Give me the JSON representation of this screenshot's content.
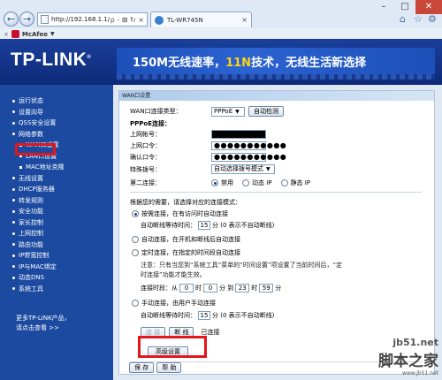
{
  "browser": {
    "url": "http://192.168.1.1/",
    "tab_title": "TL-WR745N",
    "address_icons": "ρ - ⊠ ↻ ×",
    "tab_close": "×",
    "toolbar": {
      "mcafee_label": "McAfee"
    }
  },
  "banner": {
    "logo": "TP-LINK",
    "logo_reg": "®",
    "slogan_pre": "150M无线速率，",
    "slogan_accent": "11N",
    "slogan_post": "技术，无线生活新选择"
  },
  "sidebar": {
    "items": [
      {
        "label": "运行状态"
      },
      {
        "label": "设置向导"
      },
      {
        "label": "QSS安全设置"
      },
      {
        "label": "网络参数"
      },
      {
        "label": "WAN口设置"
      },
      {
        "label": "LAN口设置"
      },
      {
        "label": "MAC地址克隆"
      },
      {
        "label": "无线设置"
      },
      {
        "label": "DHCP服务器"
      },
      {
        "label": "转发规则"
      },
      {
        "label": "安全功能"
      },
      {
        "label": "家长控制"
      },
      {
        "label": "上网控制"
      },
      {
        "label": "路由功能"
      },
      {
        "label": "IP带宽控制"
      },
      {
        "label": "IP与MAC绑定"
      },
      {
        "label": "动态DNS"
      },
      {
        "label": "系统工具"
      }
    ],
    "more_line1": "更多TP-LINK产品，",
    "more_line2": "请点击查看 >>"
  },
  "panel": {
    "title": "WAN口设置",
    "conn_type_label": "WAN口连接类型：",
    "conn_type_value": "PPPoE",
    "auto_detect": "自动检测",
    "pppoe_label": "PPPoE连接：",
    "account_label": "上网帐号：",
    "password_label": "上网口令：",
    "confirm_label": "确认口令：",
    "password_mask": "●●●●●●●●●●●",
    "special_dial_label": "特殊拨号：",
    "special_dial_value": "自动选择拨号模式",
    "second_conn_label": "第二连接：",
    "second_opts": [
      "禁用",
      "动态 IP",
      "静态 IP"
    ],
    "mode_prompt": "根据您的需要，请选择对应的连接模式：",
    "mode_on_demand": "按需连接，在有访问时自动连接",
    "idle_label": "自动断线等待时间：",
    "idle_value": "15",
    "idle_unit": "分 (0 表示不自动断线)",
    "mode_auto": "自动连接，在开机和断线后自动连接",
    "mode_timed": "定时连接，在指定的时间段自动连接",
    "timed_note1": "注意：只有当您到“系统工具”菜单的“时间设置”项设置了当前时间后，“定",
    "timed_note2": "时连接”功能才能生效。",
    "timed_period_label": "连接时段：从",
    "t_from_h": "0",
    "t_from_m": "0",
    "t_to_h": "23",
    "t_to_m": "59",
    "t_hour": "时",
    "t_min": "分",
    "t_to": "分 到",
    "mode_manual": "手动连接，由用户手动连接",
    "manual_idle_value": "15",
    "connect_btn": "连 接",
    "disconnect_btn": "断 线",
    "status_text": "已连接",
    "advanced_btn": "高级设置",
    "save_btn": "保 存",
    "help_btn": "帮 助"
  },
  "watermark": {
    "line1": "jb51.net",
    "line2": "脚本之家",
    "line3": "www.jb51.net"
  },
  "colors": {
    "sidebar_bg": "#1b4aa0",
    "banner_bg": "#0d2a78",
    "highlight_box": "#e2171c",
    "slogan_accent": "#ffd21a"
  }
}
